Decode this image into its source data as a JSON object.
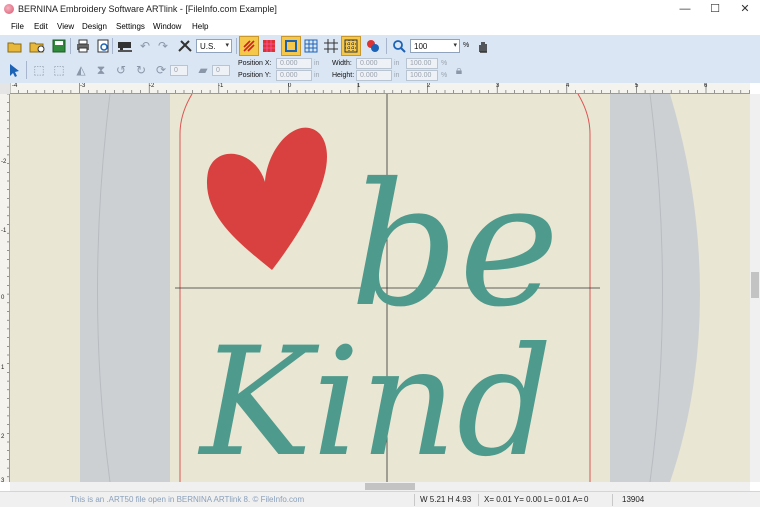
{
  "window": {
    "title": "BERNINA Embroidery Software ARTlink - [FileInfo.com Example]",
    "controls": {
      "minimize": "—",
      "maximize": "☐",
      "close": "✕"
    }
  },
  "menu": [
    "File",
    "Edit",
    "View",
    "Design",
    "Settings",
    "Window",
    "Help"
  ],
  "toolbar": {
    "units": "U.S.",
    "zoom": "100",
    "zoom_unit": "%",
    "rotate_value": "0",
    "slant_value": "0",
    "position_x_label": "Position X:",
    "position_y_label": "Position Y:",
    "width_label": "Width:",
    "height_label": "Height:",
    "position_x": "0.000",
    "position_y": "0.000",
    "width": "0.000",
    "height": "0.000",
    "unit_in": "in",
    "scale_w": "100.00",
    "scale_h": "100.00",
    "pct": "%"
  },
  "ruler": {
    "top": [
      "-4",
      "-3",
      "-2",
      "-1",
      "0",
      "1",
      "2",
      "3",
      "4",
      "5",
      "6"
    ],
    "left": [
      "-2",
      "-1",
      "0",
      "1",
      "2",
      "3"
    ]
  },
  "design": {
    "word1": "be",
    "word2": "Kind",
    "heart_color": "#d8413f",
    "thread_color": "#4e9a8c",
    "hoop_color": "#cdd0d3",
    "fabric_color": "#e9e6d3"
  },
  "status": {
    "watermark": "This is an .ART50 file open in BERNINA ARTlink 8. © FileInfo.com",
    "size": "W 5.21 H 4.93",
    "coords": "X= 0.01 Y= 0.00 L= 0.01 A=",
    "angle": "0",
    "stitch_count": "13904"
  }
}
